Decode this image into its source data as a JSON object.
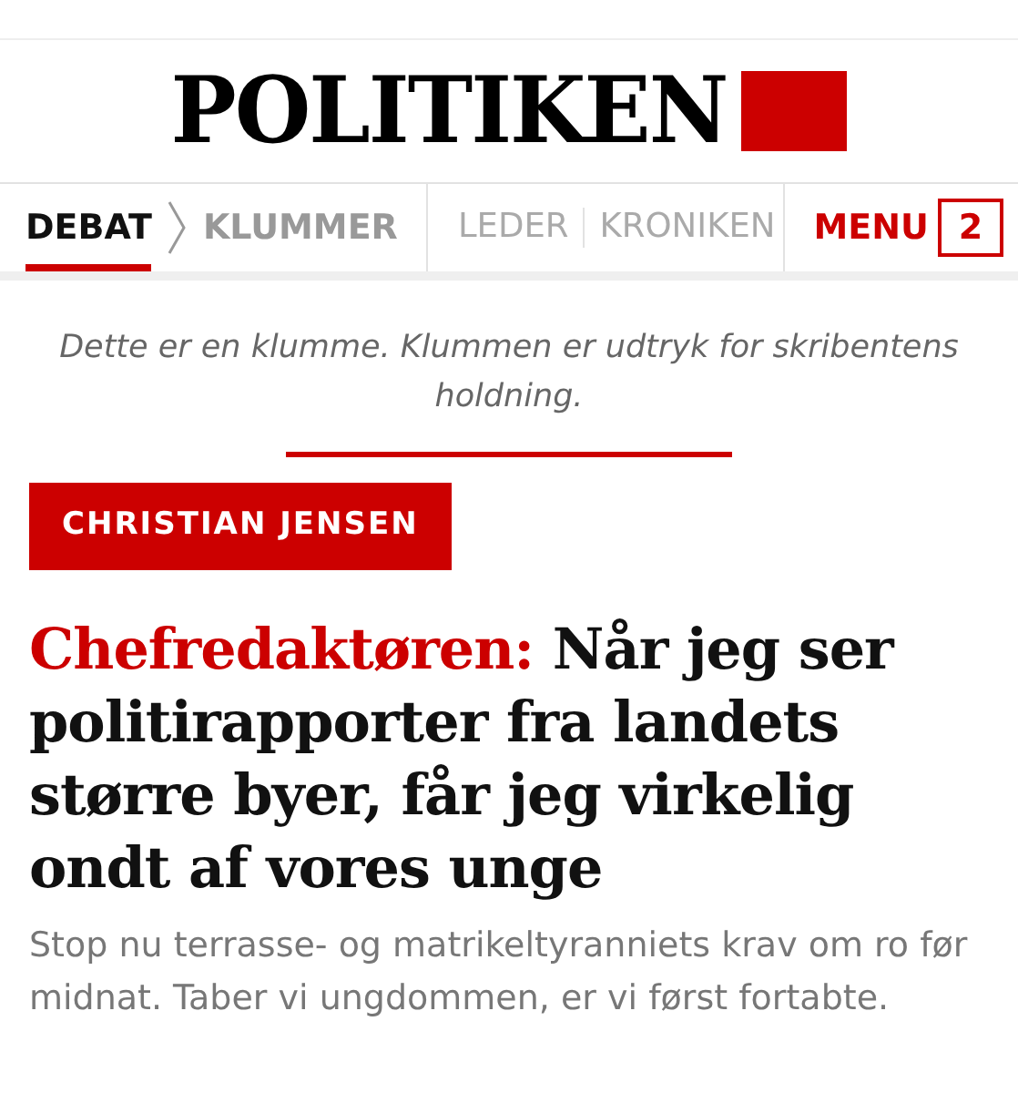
{
  "logo": {
    "text": "POLITIKEN"
  },
  "nav": {
    "items": [
      {
        "label": "DEBAT",
        "kind": "crumb",
        "selected": true
      },
      {
        "label": "KLUMMER",
        "kind": "crumb",
        "selected": false
      },
      {
        "label": "LEDER",
        "kind": "section",
        "selected": false
      },
      {
        "label": "KRONIKEN",
        "kind": "section",
        "selected": false
      }
    ],
    "menu": "MENU",
    "badge": "2"
  },
  "disclaimer": "Dette er en klumme. Klummen er udtryk for skribentens holdning.",
  "author": "CHRISTIAN JENSEN",
  "kicker": "Chefredaktøren:",
  "headline": "Når jeg ser politirapporter fra landets større byer, får jeg virkelig ondt af vores unge",
  "lead": "Stop nu terrasse- og matrikeltyranniets krav om ro før midnat. Taber vi ungdommen, er vi først fortabte."
}
